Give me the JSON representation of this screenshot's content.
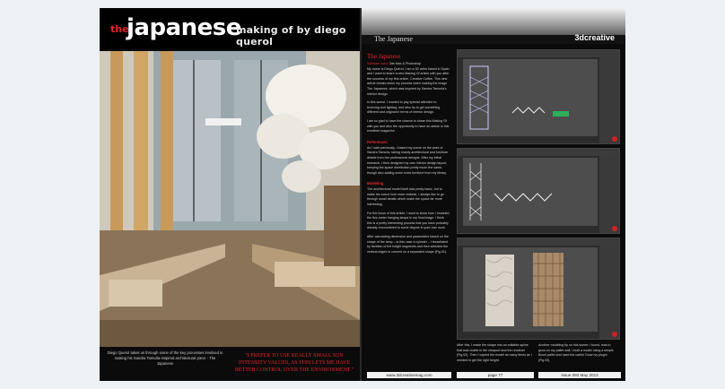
{
  "left_page": {
    "title_the": "the",
    "title_main": "japanese",
    "title_sub": "making of by diego querol",
    "caption": "Diego Querol takes us through some of the key processes involved in making his Sandra Tamurla-inspired architectural piece - The Japanese",
    "quote": "\"I PREFER TO USE REALLY SMALL SUN INTENSITY VALUES, AS THIS LETS ME HAVE BETTER CONTROL OVER THE ENVIRONMENT.\""
  },
  "right_page": {
    "section_title": "The Japanese",
    "brand": "3dcreative",
    "article_title": "The Japanese",
    "software_label": "Software used:",
    "software_value": "3ds Max & Photoshop",
    "intro_1": "My name is Diego Querol, I am a 3D artist based in Spain and I want to share a new Making Of article with you after the success of my first article, Creative Coffee. This new article breaks down my process when making the image The Japanese, which was inspired by Sandra Tamurla's interior design.",
    "intro_2": "In this scene, I wanted to pay special attention to texturing and lighting, and also try to get something different and original in terms of interior design.",
    "intro_3": "I am so glad to have the chance to share this Making Of with you and also the opportunity to have an article in this excellent magazine.",
    "references_heading": "References",
    "references_text": "As I said previously, I based my scene on the work of Sandra Tamurla, taking mainly architectural and furniture details from her professional designs. After my initial research, I then designed my own interior design layout, keeping the space distribution pretty much the same, though also adding some extra furniture from my library.",
    "modeling_heading": "Modeling",
    "modeling_1": "The architectural model itself was pretty basic, but to make the scene look more realistic, I always like to go through small details which make the space far more interesting.",
    "modeling_2": "For the focus of this article, I want to show how I modeled the five-meter hanging lamps in my final image. I think this is a pretty interesting process that you have probably already encountered to some degree in your own work.",
    "modeling_3": "After calculating dimension and parameters based on the shape of the lamp – in this case a cylinder – I tessellated by facetion of the height segments and then selected the vertical edges to convert on a separated shape (Fig.01).",
    "col2_text": "After this, I made the shape into an editable spline that was visible in the viewport and the renderer (Fig.02). Then I copied the model as many times as I needed to get the right height.",
    "col3_text": "Another modeling tip on this scene: I found, was to grow on my pallet wall. I built a model using a simple Boxel pallet and used the useful Grow Ivy plugin (Fig.03).",
    "footer_1": "www.3dcreativemag.com",
    "footer_2": "page 77",
    "footer_3": "Issue 093 May 2013"
  },
  "colors": {
    "accent": "#e3262b",
    "page_bg": "#0b0b0b",
    "canvas": "#eef1f3"
  }
}
